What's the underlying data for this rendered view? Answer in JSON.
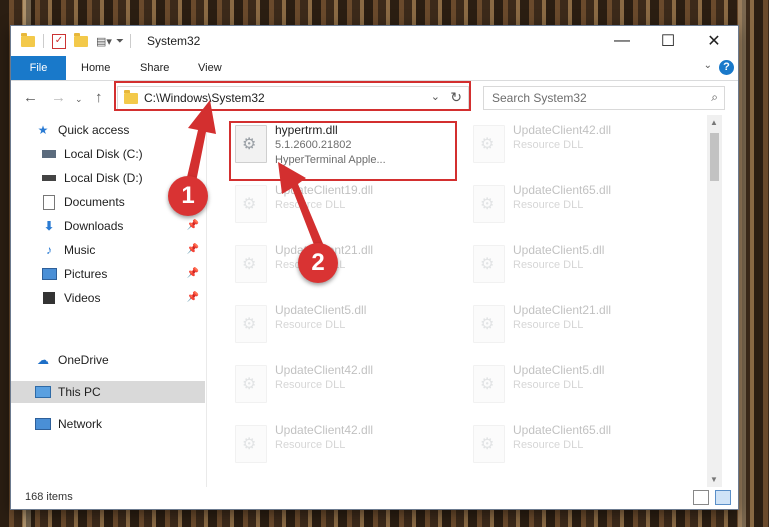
{
  "window": {
    "title": "System32"
  },
  "ribbon": {
    "tabs": [
      "File",
      "Home",
      "Share",
      "View"
    ],
    "help": "?"
  },
  "address": {
    "path": "C:\\Windows\\System32"
  },
  "search": {
    "placeholder": "Search System32"
  },
  "sidebar": {
    "items": [
      {
        "label": "Quick access",
        "icon": "star-icon"
      },
      {
        "label": "Local Disk (C:)",
        "icon": "drive-icon"
      },
      {
        "label": "Local Disk (D:)",
        "icon": "drive-icon"
      },
      {
        "label": "Documents",
        "icon": "document-icon"
      },
      {
        "label": "Downloads",
        "icon": "download-icon"
      },
      {
        "label": "Music",
        "icon": "music-icon"
      },
      {
        "label": "Pictures",
        "icon": "pictures-icon"
      },
      {
        "label": "Videos",
        "icon": "video-icon"
      },
      {
        "label": "OneDrive",
        "icon": "cloud-icon"
      },
      {
        "label": "This PC",
        "icon": "computer-icon"
      },
      {
        "label": "Network",
        "icon": "network-icon"
      }
    ]
  },
  "files": {
    "highlighted": {
      "name": "hypertrm.dll",
      "version": "5.1.2600.21802",
      "description": "HyperTerminal Apple..."
    },
    "faded": [
      {
        "name": "UpdateClient42.dll",
        "type": "Resource DLL"
      },
      {
        "name": "UpdateClient19.dll",
        "type": "Resource DLL"
      },
      {
        "name": "UpdateClient65.dll",
        "type": "Resource DLL"
      },
      {
        "name": "UpdateClient21.dll",
        "type": "Resource DLL"
      },
      {
        "name": "UpdateClient5.dll",
        "type": "Resource DLL"
      },
      {
        "name": "UpdateClient5.dll",
        "type": "Resource DLL"
      },
      {
        "name": "UpdateClient21.dll",
        "type": "Resource DLL"
      },
      {
        "name": "UpdateClient42.dll",
        "type": "Resource DLL"
      },
      {
        "name": "UpdateClient5.dll",
        "type": "Resource DLL"
      },
      {
        "name": "UpdateClient42.dll",
        "type": "Resource DLL"
      },
      {
        "name": "UpdateClient65.dll",
        "type": "Resource DLL"
      }
    ]
  },
  "status": {
    "item_count": "168 items"
  },
  "annotations": {
    "step1": "1",
    "step2": "2",
    "color": "#d32f2f"
  }
}
